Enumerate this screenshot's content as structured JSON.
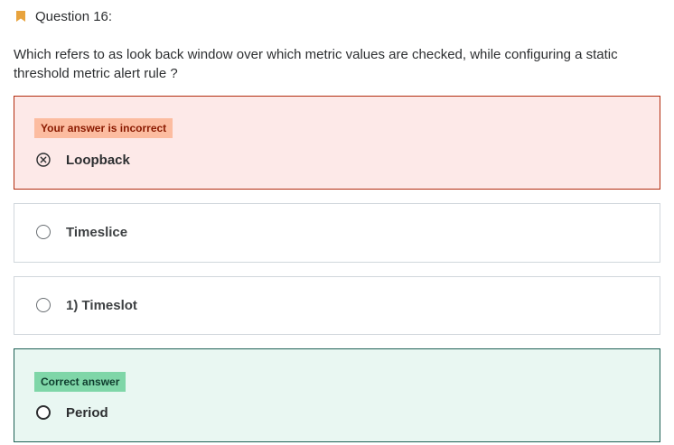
{
  "question": {
    "label": "Question 16:",
    "prompt": "Which refers to as look back window over which metric values are checked, while configuring a static threshold metric alert rule ?"
  },
  "answers": {
    "incorrect_badge": "Your answer is incorrect",
    "correct_badge": "Correct answer",
    "options": [
      {
        "label": "Loopback",
        "state": "selected-incorrect"
      },
      {
        "label": "Timeslice",
        "state": "unselected"
      },
      {
        "label": "1) Timeslot",
        "state": "unselected"
      },
      {
        "label": "Period",
        "state": "correct"
      }
    ]
  },
  "colors": {
    "bookmark": "#e8a33d",
    "incorrect_bg": "#fde9e8",
    "incorrect_border": "#b32d0f",
    "incorrect_badge_bg": "#fcbca0",
    "correct_bg": "#e9f7f2",
    "correct_border": "#1e6055",
    "correct_badge_bg": "#7fd6a8"
  },
  "icons": {
    "bookmark": "bookmark-icon",
    "incorrect_mark": "x-circle-icon",
    "radio": "radio-icon"
  }
}
